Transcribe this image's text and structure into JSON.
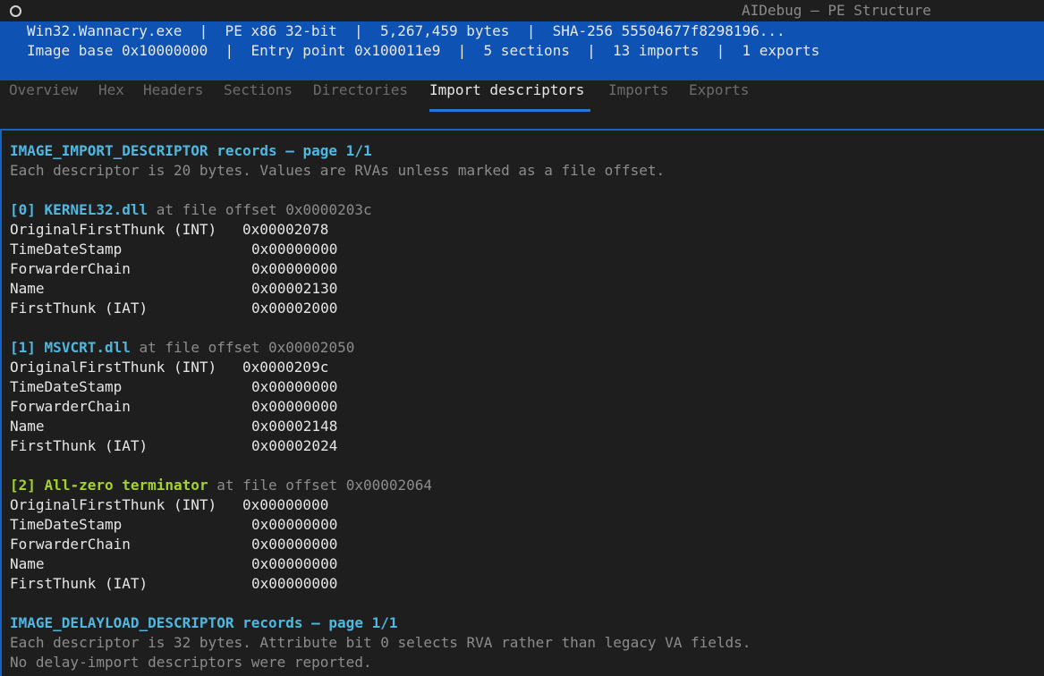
{
  "window": {
    "title": "AIDebug — PE Structure"
  },
  "info": {
    "line1": "Win32.Wannacry.exe  |  PE x86 32-bit  |  5,267,459 bytes  |  SHA-256 55504677f8298196...",
    "line2": "Image base 0x10000000  |  Entry point 0x100011e9  |  5 sections  |  13 imports  |  1 exports"
  },
  "tabs": [
    {
      "label": "Overview"
    },
    {
      "label": "Hex"
    },
    {
      "label": "Headers"
    },
    {
      "label": "Sections"
    },
    {
      "label": "Directories"
    },
    {
      "label": "Import descriptors"
    },
    {
      "label": "Imports"
    },
    {
      "label": "Exports"
    }
  ],
  "active_tab": "Import descriptors",
  "import_section": {
    "title": "IMAGE_IMPORT_DESCRIPTOR records — page 1/1",
    "description": "Each descriptor is 20 bytes. Values are RVAs unless marked as a file offset."
  },
  "descriptors": [
    {
      "index": "[0]",
      "name": "KERNEL32.dll",
      "offset_text": "at file offset 0x0000203c",
      "fields": [
        {
          "label": "OriginalFirstThunk (INT)",
          "value": "0x00002078"
        },
        {
          "label": "TimeDateStamp",
          "value": "0x00000000"
        },
        {
          "label": "ForwarderChain",
          "value": "0x00000000"
        },
        {
          "label": "Name",
          "value": "0x00002130"
        },
        {
          "label": "FirstThunk (IAT)",
          "value": "0x00002000"
        }
      ]
    },
    {
      "index": "[1]",
      "name": "MSVCRT.dll",
      "offset_text": "at file offset 0x00002050",
      "fields": [
        {
          "label": "OriginalFirstThunk (INT)",
          "value": "0x0000209c"
        },
        {
          "label": "TimeDateStamp",
          "value": "0x00000000"
        },
        {
          "label": "ForwarderChain",
          "value": "0x00000000"
        },
        {
          "label": "Name",
          "value": "0x00002148"
        },
        {
          "label": "FirstThunk (IAT)",
          "value": "0x00002024"
        }
      ]
    },
    {
      "index": "[2]",
      "name": "All-zero terminator",
      "offset_text": "at file offset 0x00002064",
      "fields": [
        {
          "label": "OriginalFirstThunk (INT)",
          "value": "0x00000000"
        },
        {
          "label": "TimeDateStamp",
          "value": "0x00000000"
        },
        {
          "label": "ForwarderChain",
          "value": "0x00000000"
        },
        {
          "label": "Name",
          "value": "0x00000000"
        },
        {
          "label": "FirstThunk (IAT)",
          "value": "0x00000000"
        }
      ]
    }
  ],
  "delayload_section": {
    "title": "IMAGE_DELAYLOAD_DESCRIPTOR records — page 1/1",
    "description": "Each descriptor is 32 bytes. Attribute bit 0 selects RVA rather than legacy VA fields.",
    "note": "No delay-import descriptors were reported."
  },
  "colors": {
    "info_bar": "#0e52b3",
    "accent": "#1f7ad8",
    "heading": "#4fb8e0",
    "terminator": "#a6d22e"
  }
}
